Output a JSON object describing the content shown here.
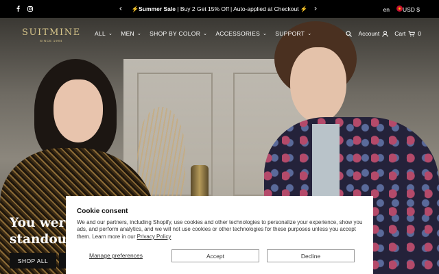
{
  "announcement": {
    "promo_bold": "⚡Summer Sale",
    "promo_rest": " | Buy 2 Get 15% Off | Auto-applied at Checkout ⚡",
    "prev_arrow": "‹",
    "next_arrow": "›",
    "language": "en",
    "currency": "USD $",
    "social": [
      "facebook-icon",
      "instagram-icon"
    ]
  },
  "header": {
    "logo": "SUITMINE",
    "logo_sub": "SINCE 1984",
    "nav": [
      {
        "label": "ALL"
      },
      {
        "label": "MEN"
      },
      {
        "label": "SHOP BY COLOR"
      },
      {
        "label": "ACCESSORIES"
      },
      {
        "label": "SUPPORT"
      }
    ],
    "account_label": "Account",
    "cart_label": "Cart",
    "cart_count": "0"
  },
  "hero": {
    "headline_line1": "You were",
    "headline_line2": "standout",
    "cta": "SHOP ALL"
  },
  "cookie": {
    "title": "Cookie consent",
    "body": "We and our partners, including Shopify, use cookies and other technologies to personalize your experience, show you ads, and perform analytics, and we will not use cookies or other technologies for these purposes unless you accept them. Learn more in our ",
    "policy_link": "Privacy Policy",
    "manage": "Manage preferences",
    "accept": "Accept",
    "decline": "Decline"
  }
}
